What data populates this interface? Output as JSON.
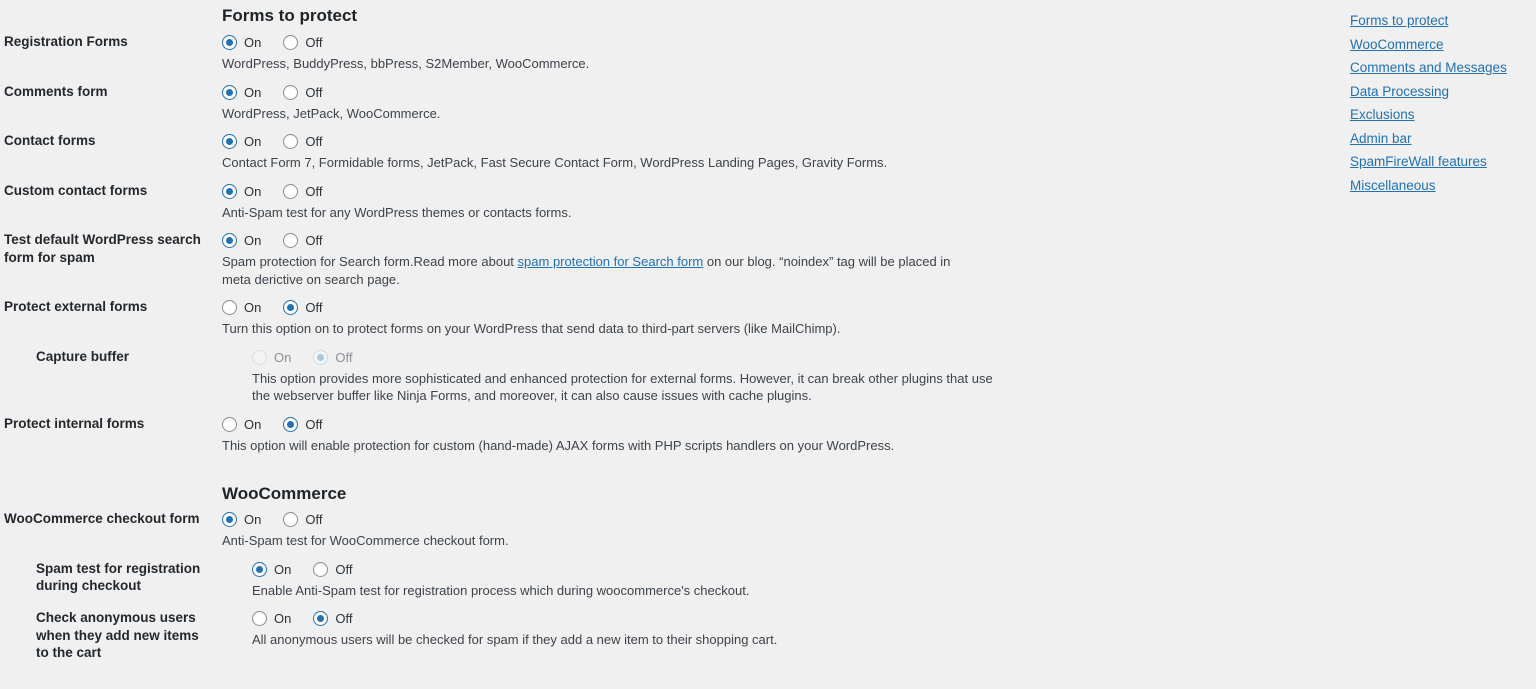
{
  "sections": [
    {
      "id": "forms-to-protect",
      "heading": "Forms to protect",
      "rows": [
        {
          "id": "registration-forms",
          "label": "Registration Forms",
          "indent": 0,
          "on_label": "On",
          "off_label": "Off",
          "value": "on",
          "disabled": false,
          "description": "WordPress, BuddyPress, bbPress, S2Member, WooCommerce."
        },
        {
          "id": "comments-form",
          "label": "Comments form",
          "indent": 0,
          "on_label": "On",
          "off_label": "Off",
          "value": "on",
          "disabled": false,
          "description": "WordPress, JetPack, WooCommerce."
        },
        {
          "id": "contact-forms",
          "label": "Contact forms",
          "indent": 0,
          "on_label": "On",
          "off_label": "Off",
          "value": "on",
          "disabled": false,
          "description": "Contact Form 7, Formidable forms, JetPack, Fast Secure Contact Form, WordPress Landing Pages, Gravity Forms."
        },
        {
          "id": "custom-contact-forms",
          "label": "Custom contact forms",
          "indent": 0,
          "on_label": "On",
          "off_label": "Off",
          "value": "on",
          "disabled": false,
          "description": "Anti-Spam test for any WordPress themes or contacts forms."
        },
        {
          "id": "test-default-wordpress-search-form-for-spam",
          "label": "Test default WordPress search form for spam",
          "indent": 0,
          "on_label": "On",
          "off_label": "Off",
          "value": "on",
          "disabled": false,
          "description_before": "Spam protection for Search form.Read more about ",
          "description_link": "spam protection for Search form",
          "description_after": " on our blog. “noindex” tag will be placed in meta derictive on search page."
        },
        {
          "id": "protect-external-forms",
          "label": "Protect external forms",
          "indent": 0,
          "on_label": "On",
          "off_label": "Off",
          "value": "off",
          "disabled": false,
          "description": "Turn this option on to protect forms on your WordPress that send data to third-part servers (like MailChimp)."
        },
        {
          "id": "capture-buffer",
          "label": "Capture buffer",
          "indent": 1,
          "on_label": "On",
          "off_label": "Off",
          "value": "off",
          "disabled": true,
          "description": "This option provides more sophisticated and enhanced protection for external forms. However, it can break other plugins that use the webserver buffer like Ninja Forms, and moreover, it can also cause issues with cache plugins."
        },
        {
          "id": "protect-internal-forms",
          "label": "Protect internal forms",
          "indent": 0,
          "on_label": "On",
          "off_label": "Off",
          "value": "off",
          "disabled": false,
          "description": "This option will enable protection for custom (hand-made) AJAX forms with PHP scripts handlers on your WordPress."
        }
      ]
    },
    {
      "id": "woocommerce",
      "heading": "WooCommerce",
      "rows": [
        {
          "id": "woocommerce-checkout-form",
          "label": "WooCommerce checkout form",
          "indent": 0,
          "on_label": "On",
          "off_label": "Off",
          "value": "on",
          "disabled": false,
          "description": "Anti-Spam test for WooCommerce checkout form."
        },
        {
          "id": "spam-test-for-registration-during-checkout",
          "label": "Spam test for registration during checkout",
          "indent": 1,
          "on_label": "On",
          "off_label": "Off",
          "value": "on",
          "disabled": false,
          "description": "Enable Anti-Spam test for registration process which during woocommerce's checkout."
        },
        {
          "id": "check-anonymous-users-when-they-add-new-items-to-the-cart",
          "label": "Check anonymous users when they add new items to the cart",
          "indent": 1,
          "on_label": "On",
          "off_label": "Off",
          "value": "off",
          "disabled": false,
          "description": "All anonymous users will be checked for spam if they add a new item to their shopping cart."
        }
      ]
    }
  ],
  "toc": {
    "links": [
      "Forms to protect",
      "WooCommerce",
      "Comments and Messages",
      "Data Processing",
      "Exclusions",
      "Admin bar",
      "SpamFireWall features",
      "Miscellaneous"
    ]
  },
  "colors": {
    "accent": "#2271b1",
    "background": "#f0f0f1",
    "label_text": "#23282d",
    "desc_text": "#3c434a"
  }
}
